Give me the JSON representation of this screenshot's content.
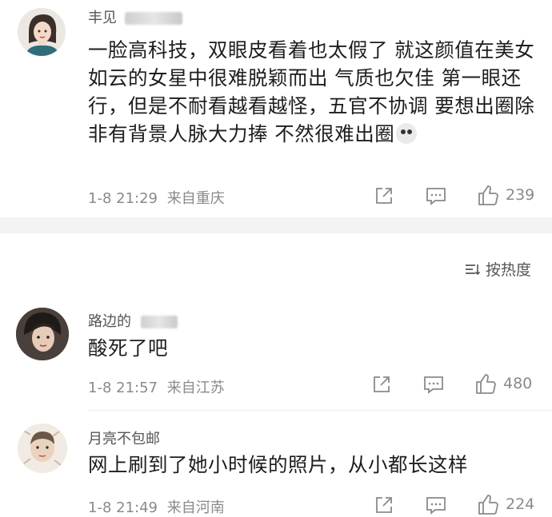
{
  "comments": [
    {
      "username": "丰见",
      "content": "一脸高科技，双眼皮看着也太假了  就这颜值在美女如云的女星中很难脱颖而出  气质也欠佳  第一眼还行，但是不耐看越看越怪，五官不协调  要想出圈除非有背景人脉大力捧  不然很难出圈",
      "time": "1-8 21:29",
      "location": "来自重庆",
      "likes": "239"
    },
    {
      "username": "路边的",
      "content": "酸死了吧",
      "time": "1-8 21:57",
      "location": "来自江苏",
      "likes": "480"
    },
    {
      "username": "月亮不包邮",
      "content": "网上刷到了她小时候的照片，从小都长这样",
      "time": "1-8 21:49",
      "location": "来自河南",
      "likes": "224"
    }
  ],
  "sort": {
    "label": "按热度"
  },
  "colors": {
    "gap": "#f3f3f5",
    "meta": "#8a8a8a",
    "text": "#1d1d1d"
  },
  "icons": [
    "share-icon",
    "comment-icon",
    "like-icon",
    "sort-icon"
  ]
}
